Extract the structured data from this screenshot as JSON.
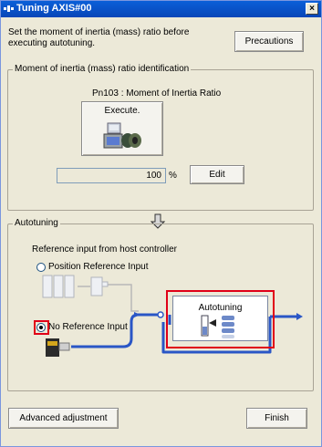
{
  "window": {
    "title": "Tuning  AXIS#00",
    "close_glyph": "×"
  },
  "intro": {
    "text_line1": "Set the moment of inertia (mass) ratio before",
    "text_line2": "executing autotuning.",
    "precautions_label": "Precautions"
  },
  "inertia": {
    "legend": "Moment of inertia (mass) ratio identification",
    "param_label": "Pn103 : Moment of Inertia Ratio",
    "execute_label": "Execute.",
    "value": "100",
    "unit": "%",
    "edit_label": "Edit"
  },
  "autotuning": {
    "legend": "Autotuning",
    "reference_heading": "Reference input from host controller",
    "option_position": "Position Reference Input",
    "option_no_reference": "No Reference Input",
    "selected_option": "No Reference Input",
    "box_label": "Autotuning"
  },
  "footer": {
    "advanced_label": "Advanced adjustment",
    "finish_label": "Finish"
  },
  "colors": {
    "highlight_red": "#e00018",
    "flow_blue": "#2a56c6",
    "inactive_gray": "#b8b8b8"
  }
}
